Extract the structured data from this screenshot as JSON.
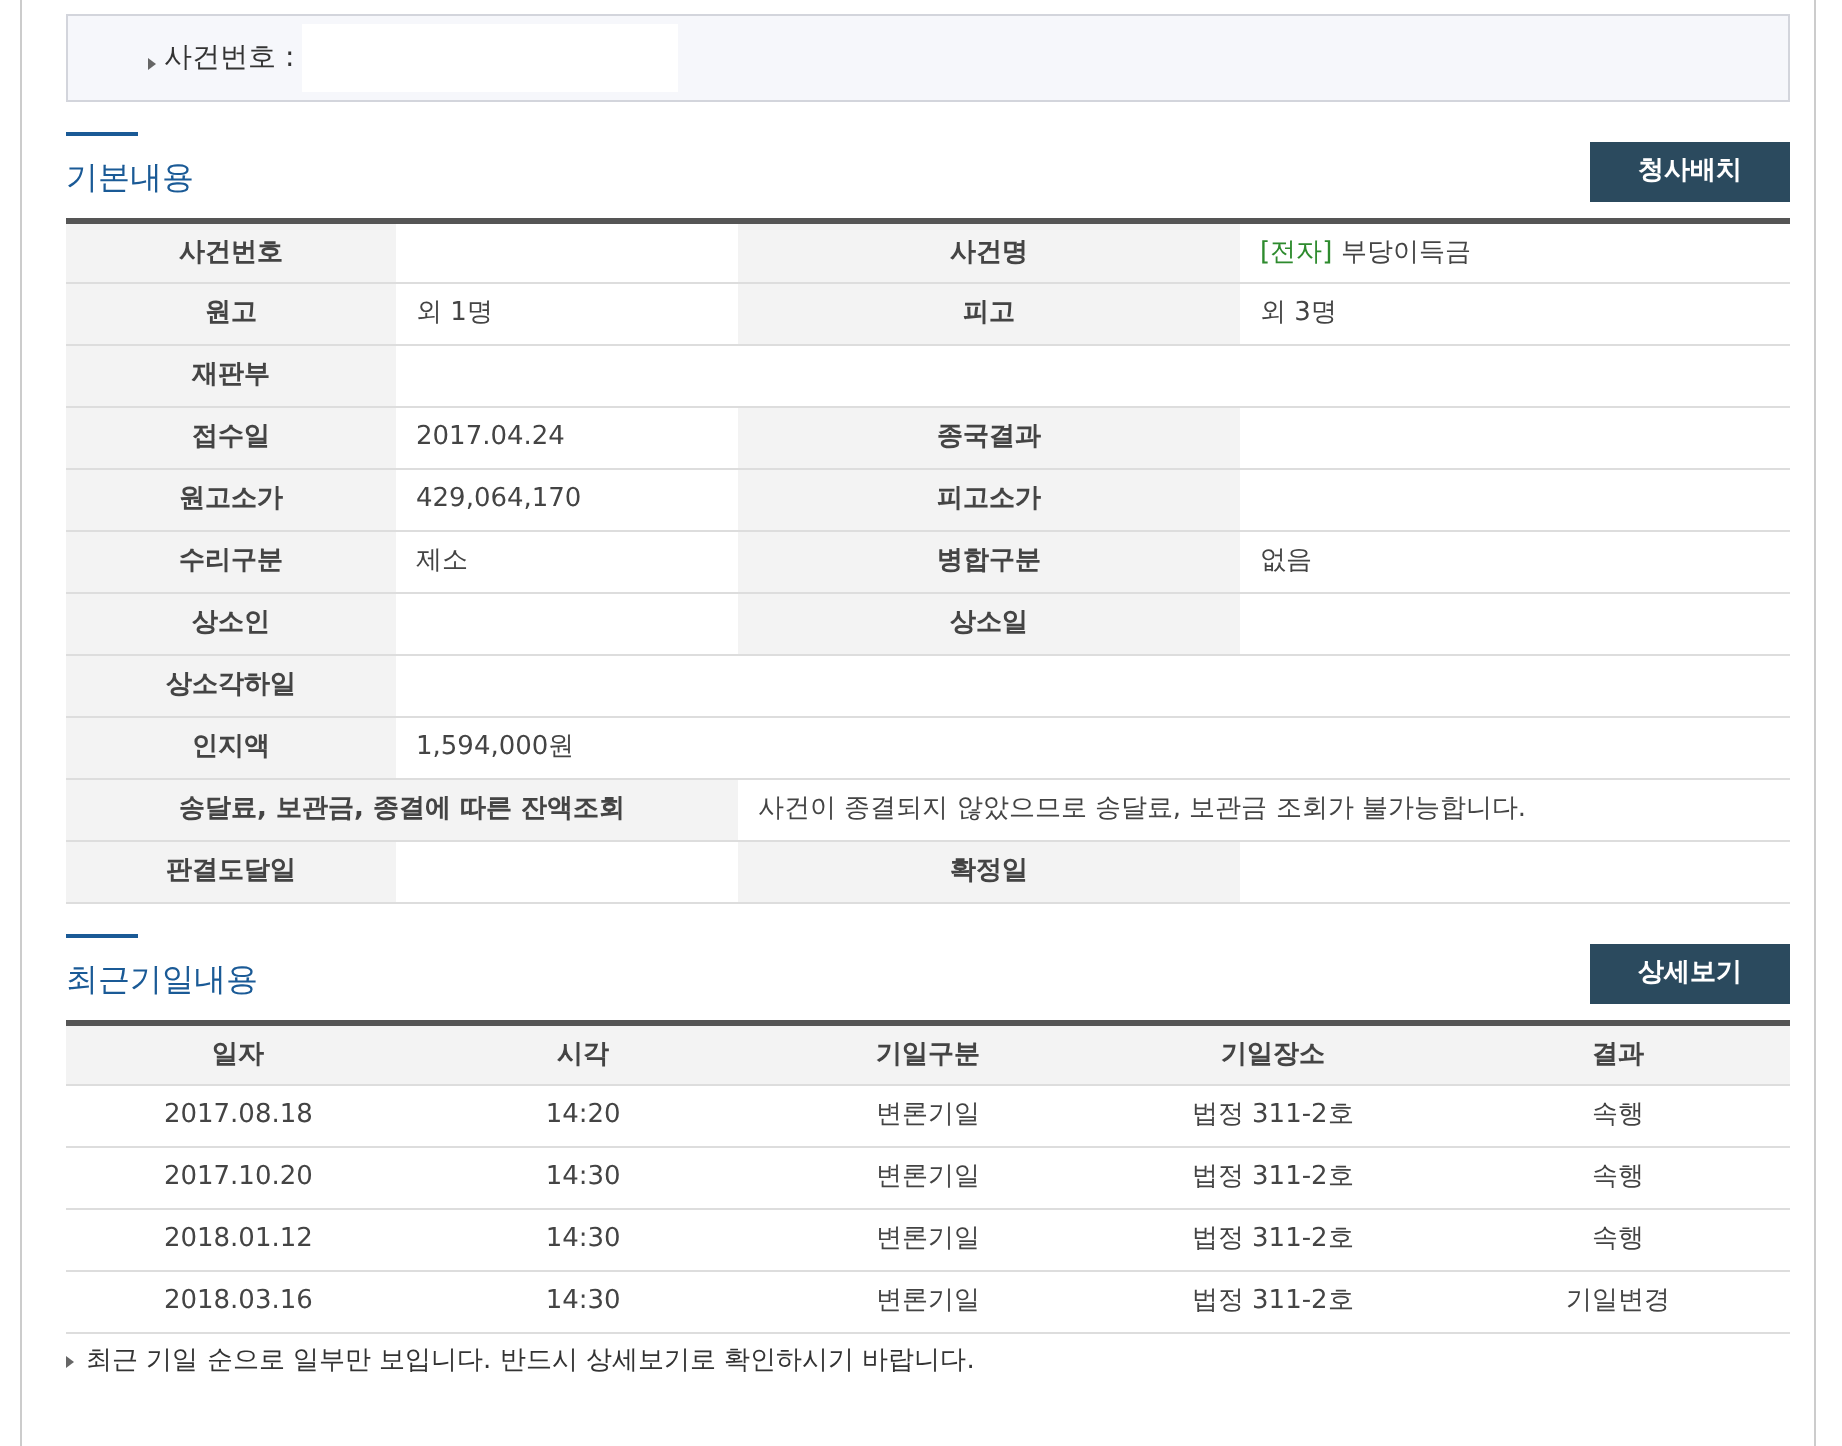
{
  "search": {
    "label": "사건번호 :"
  },
  "basic": {
    "title": "기본내용",
    "button": "청사배치",
    "rows": [
      [
        {
          "label": "사건번호"
        },
        {
          "label": "사건명",
          "tag": "[전자]",
          "value": "부당이득금"
        }
      ],
      [
        {
          "label": "원고",
          "value": "외 1명"
        },
        {
          "label": "피고",
          "value": "외 3명"
        }
      ],
      [
        {
          "label": "재판부"
        }
      ],
      [
        {
          "label": "접수일",
          "value": "2017.04.24"
        },
        {
          "label": "종국결과"
        }
      ],
      [
        {
          "label": "원고소가",
          "value": "429,064,170"
        },
        {
          "label": "피고소가"
        }
      ],
      [
        {
          "label": "수리구분",
          "value": "제소"
        },
        {
          "label": "병합구분",
          "value": "없음"
        }
      ],
      [
        {
          "label": "상소인"
        },
        {
          "label": "상소일"
        }
      ],
      [
        {
          "label": "상소각하일"
        }
      ],
      [
        {
          "label": "인지액",
          "value": "1,594,000원"
        }
      ],
      [
        {
          "label": "송달료, 보관금, 종결에 따른 잔액조회",
          "value": "사건이 종결되지 않았으므로 송달료, 보관금 조회가 불가능합니다.",
          "kind": "wide"
        }
      ],
      [
        {
          "label": "판결도달일"
        },
        {
          "label": "확정일"
        }
      ]
    ]
  },
  "hearings": {
    "title": "최근기일내용",
    "button": "상세보기",
    "columns": [
      "일자",
      "시각",
      "기일구분",
      "기일장소",
      "결과"
    ],
    "rows": [
      [
        "2017.08.18",
        "14:20",
        "변론기일",
        "법정 311-2호",
        "속행"
      ],
      [
        "2017.10.20",
        "14:30",
        "변론기일",
        "법정 311-2호",
        "속행"
      ],
      [
        "2018.01.12",
        "14:30",
        "변론기일",
        "법정 311-2호",
        "속행"
      ],
      [
        "2018.03.16",
        "14:30",
        "변론기일",
        "법정 311-2호",
        "기일변경"
      ]
    ],
    "note": "최근 기일 순으로 일부만 보입니다. 반드시 상세보기로 확인하시기 바랍니다."
  }
}
